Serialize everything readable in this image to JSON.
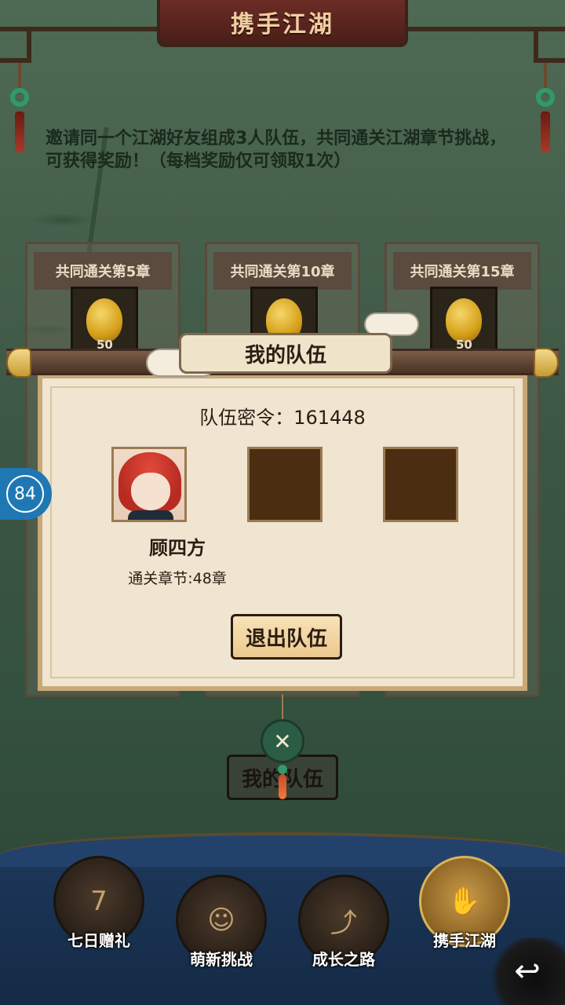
{
  "header": {
    "title": "携手江湖"
  },
  "description": "邀请同一个江湖好友组成3人队伍，共同通关江湖章节挑战，可获得奖励！（每档奖励仅可领取1次）",
  "chapters": [
    {
      "label": "共同通关第5章",
      "reward_count": "50"
    },
    {
      "label": "共同通关第10章",
      "reward_count": ""
    },
    {
      "label": "共同通关第15章",
      "reward_count": "50"
    }
  ],
  "side_badge": {
    "value": "84"
  },
  "modal": {
    "title": "我的队伍",
    "password_label": "队伍密令：161448",
    "member": {
      "name": "顾四方",
      "progress": "通关章节:48章"
    },
    "exit_button": "退出队伍"
  },
  "my_team_button": "我的队伍",
  "bottom_nav": [
    {
      "label": "七日赠礼",
      "icon": "gift-box-icon",
      "active": false
    },
    {
      "label": "萌新挑战",
      "icon": "cute-face-icon",
      "active": false
    },
    {
      "label": "成长之路",
      "icon": "book-arrow-icon",
      "active": false
    },
    {
      "label": "携手江湖",
      "icon": "handshake-icon",
      "active": true
    }
  ],
  "colors": {
    "background": "#3c5644",
    "modal_bg": "#f0e5d1",
    "button_bg": "#ecc98d",
    "nav_bg": "#23426b",
    "accent_blue": "#1f78b4"
  }
}
